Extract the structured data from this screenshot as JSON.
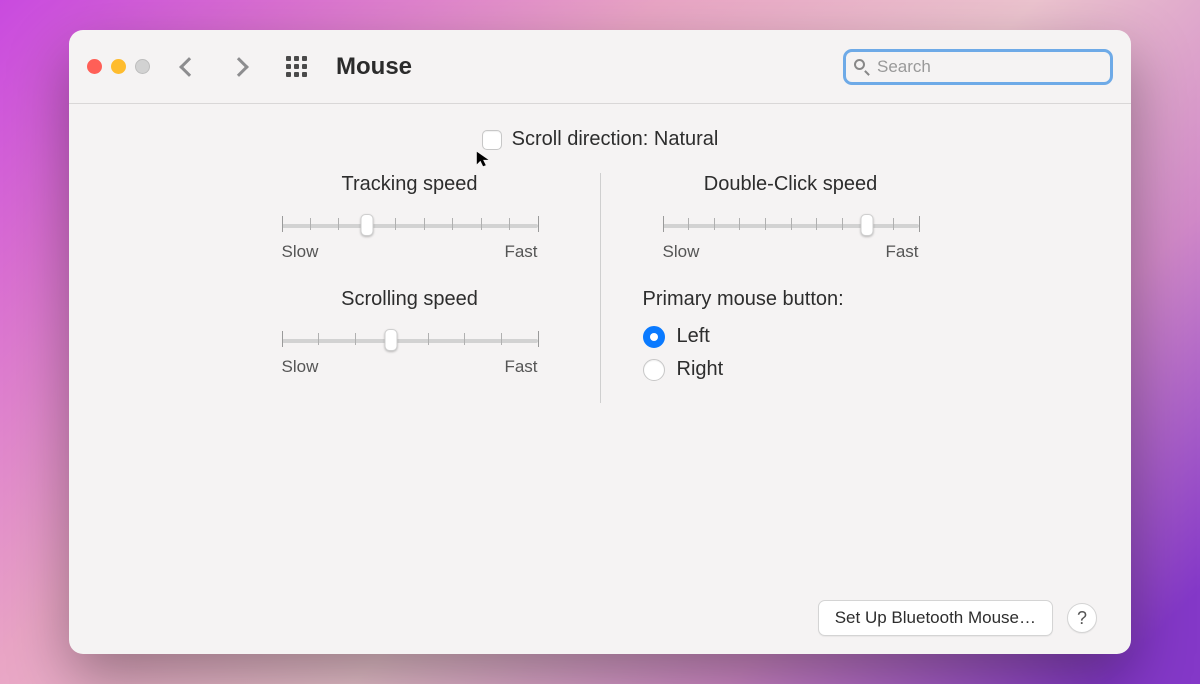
{
  "window": {
    "title": "Mouse"
  },
  "search": {
    "placeholder": "Search",
    "value": ""
  },
  "scroll_direction": {
    "label": "Scroll direction: Natural",
    "checked": false
  },
  "sliders": {
    "tracking": {
      "title": "Tracking speed",
      "min_label": "Slow",
      "max_label": "Fast",
      "ticks": 10,
      "value_index": 3
    },
    "scrolling": {
      "title": "Scrolling speed",
      "min_label": "Slow",
      "max_label": "Fast",
      "ticks": 8,
      "value_index": 3
    },
    "doubleclick": {
      "title": "Double-Click speed",
      "min_label": "Slow",
      "max_label": "Fast",
      "ticks": 11,
      "value_index": 8
    }
  },
  "primary_button": {
    "title": "Primary mouse button:",
    "options": {
      "left": "Left",
      "right": "Right"
    },
    "selected": "left"
  },
  "footer": {
    "bluetooth_button": "Set Up Bluetooth Mouse…",
    "help": "?"
  }
}
